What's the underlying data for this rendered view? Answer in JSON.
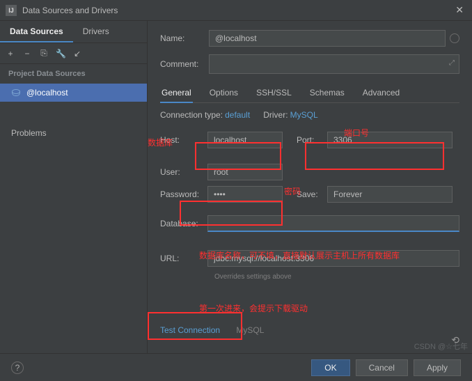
{
  "window": {
    "title": "Data Sources and Drivers"
  },
  "leftTabs": {
    "datasources": "Data Sources",
    "drivers": "Drivers"
  },
  "sidebar": {
    "header": "Project Data Sources",
    "item": "@localhost",
    "problems": "Problems"
  },
  "form": {
    "name_label": "Name:",
    "name_value": "@localhost",
    "comment_label": "Comment:"
  },
  "subtabs": {
    "general": "General",
    "options": "Options",
    "sshssl": "SSH/SSL",
    "schemas": "Schemas",
    "advanced": "Advanced"
  },
  "conn": {
    "type_label": "Connection type:",
    "type_value": "default",
    "driver_label": "Driver:",
    "driver_value": "MySQL"
  },
  "fields": {
    "host_label": "Host:",
    "host_value": "localhost",
    "port_label": "Port:",
    "port_value": "3306",
    "user_label": "User:",
    "user_value": "root",
    "password_label": "Password:",
    "password_value": "••••",
    "save_label": "Save:",
    "save_value": "Forever",
    "database_label": "Database:",
    "database_value": "",
    "url_label": "URL:",
    "url_value": "jdbc:mysql://localhost:3306",
    "url_hint": "Overrides settings above"
  },
  "test": {
    "link": "Test Connection",
    "dbname": "MySQL"
  },
  "buttons": {
    "ok": "OK",
    "cancel": "Cancel",
    "apply": "Apply"
  },
  "annotations": {
    "host": "数据库",
    "port": "端口号",
    "password": "密码",
    "database": "数据库名称，可不填，直接默认展示主机上所有数据库",
    "test": "第一次进来，会提示下载驱动"
  },
  "watermark": "CSDN @☆七年"
}
